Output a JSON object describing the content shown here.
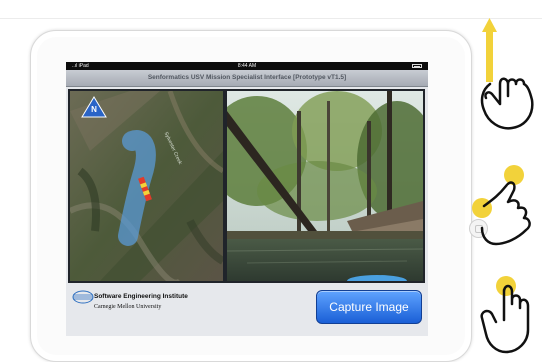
{
  "status_bar": {
    "carrier": "..ıl iPad",
    "time": "8:44 AM"
  },
  "app": {
    "title": "Senformatics USV Mission Specialist Interface [Prototype vT1.5]"
  },
  "map": {
    "north_label": "N",
    "area_label": "Sylvester Creek"
  },
  "footer": {
    "institute": "Software Engineering Institute",
    "university": "Carnegie Mellon University"
  },
  "actions": {
    "capture_label": "Capture Image"
  },
  "colors": {
    "capture_button": "#2d74e8",
    "gesture_accent": "#f2d23a",
    "north_badge": "#2a64c7",
    "route_overlay": "#5a9ad6"
  },
  "gesture_hints": [
    {
      "icon": "swipe-up-hand-icon"
    },
    {
      "icon": "pinch-hand-icon"
    },
    {
      "icon": "tap-hand-icon"
    }
  ]
}
